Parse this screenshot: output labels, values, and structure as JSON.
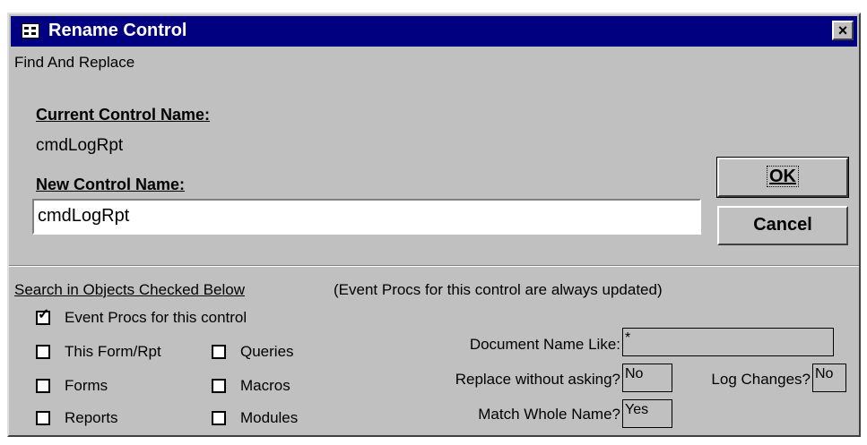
{
  "window": {
    "title": "Rename Control",
    "close_label": "×",
    "subtitle": "Find And Replace"
  },
  "current": {
    "label": "Current Control Name:",
    "value": "cmdLogRpt"
  },
  "new_name": {
    "label": "New Control Name:",
    "value": "cmdLogRpt"
  },
  "buttons": {
    "ok_label": "OK",
    "cancel_label": "Cancel"
  },
  "search": {
    "heading": "Search in Objects Checked Below",
    "note": "(Event Procs for this control are always updated)"
  },
  "checkboxes": [
    {
      "label": "Event Procs for this control",
      "checked": true
    },
    {
      "label": "This Form/Rpt",
      "checked": false
    },
    {
      "label": "Queries",
      "checked": false
    },
    {
      "label": "Forms",
      "checked": false
    },
    {
      "label": "Macros",
      "checked": false
    },
    {
      "label": "Reports",
      "checked": false
    },
    {
      "label": "Modules",
      "checked": false
    }
  ],
  "options": {
    "doc_name_label": "Document Name Like:",
    "doc_name_value": "*",
    "replace_label": "Replace without asking?",
    "replace_value": "No",
    "log_label": "Log Changes?",
    "log_value": "No",
    "match_label": "Match Whole Name?",
    "match_value": "Yes"
  }
}
